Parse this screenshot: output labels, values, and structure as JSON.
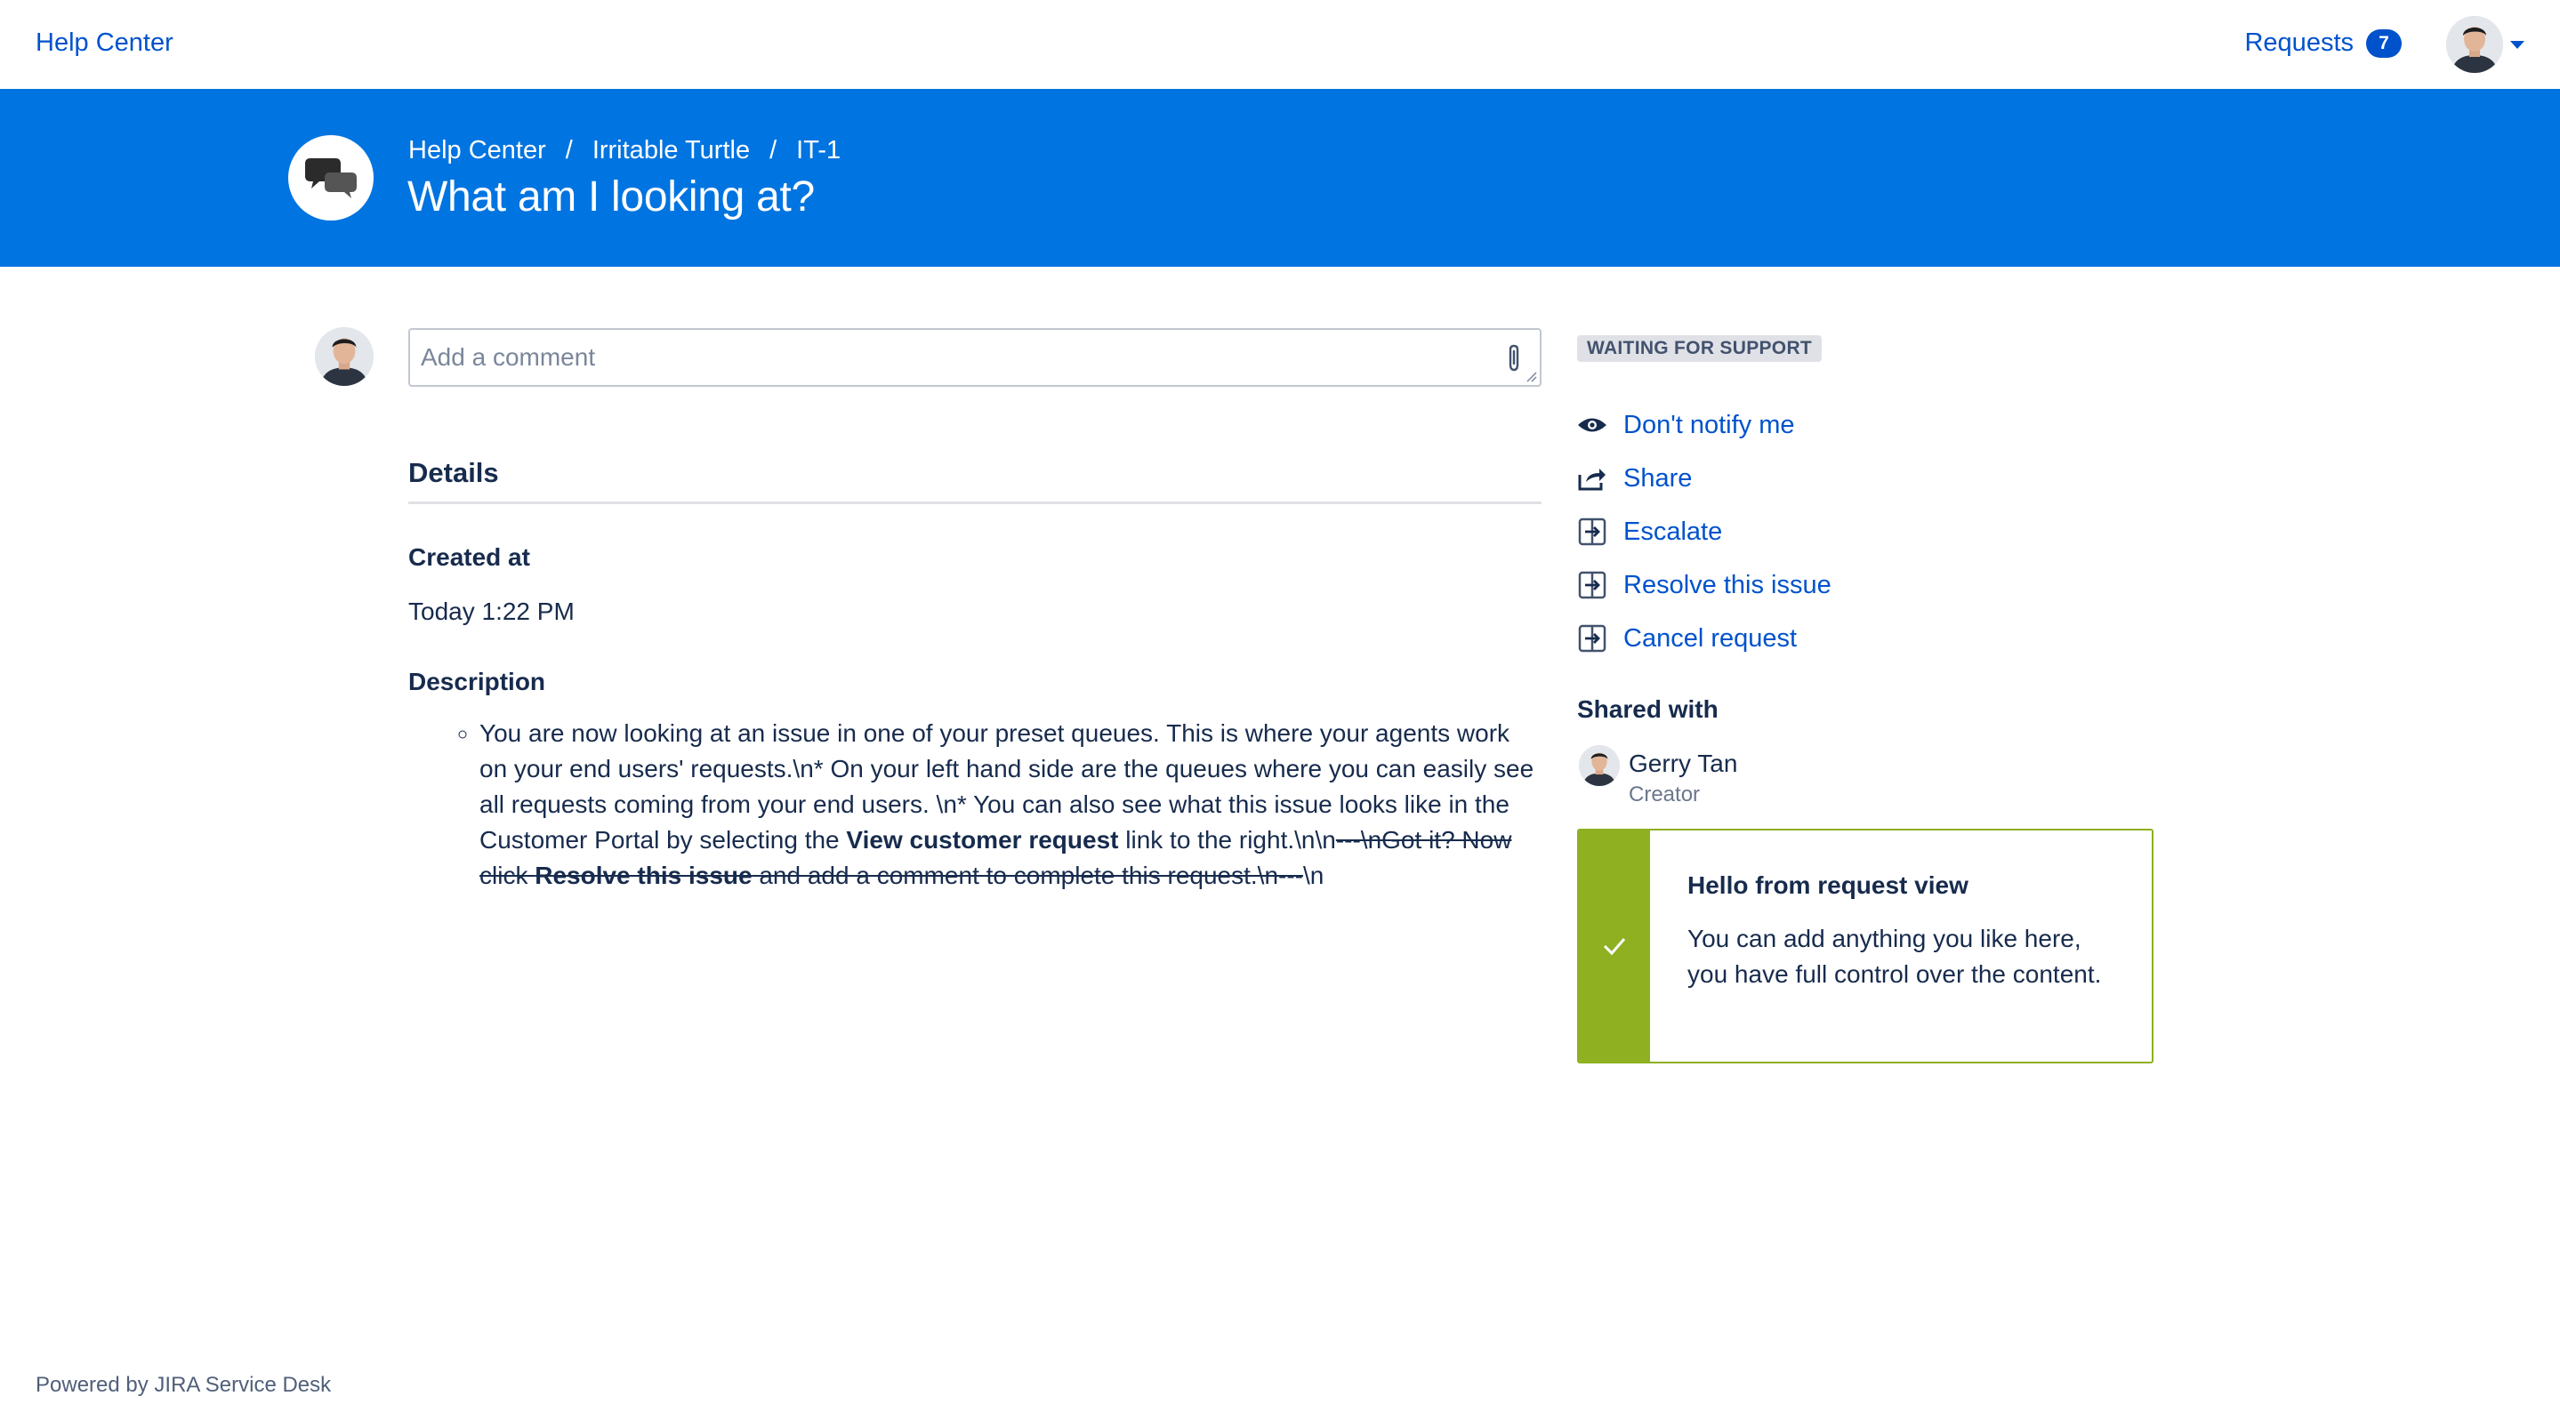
{
  "topbar": {
    "help_center": "Help Center",
    "requests_label": "Requests",
    "requests_count": "7",
    "user_menu_icon": "chevron-down-icon"
  },
  "banner": {
    "logo_icon": "speech-bubbles-icon",
    "breadcrumb": [
      "Help Center",
      "Irritable Turtle",
      "IT-1"
    ],
    "separator": "/",
    "title": "What am I looking at?"
  },
  "comment": {
    "placeholder": "Add a comment",
    "attach_icon": "paperclip-icon"
  },
  "details": {
    "heading": "Details",
    "created_label": "Created at",
    "created_value": "Today 1:22 PM",
    "description_label": "Description",
    "description": {
      "part1": "You are now looking at an issue in one of your preset queues. This is where your agents work on your end users' requests.\\n* On your left hand side are the queues where you can easily see all requests coming from your end users. \\n* You can also see what this issue looks like in the Customer Portal by selecting the ",
      "bold1": "View customer request",
      "part2": " link to the right.\\n\\n",
      "strike1": "---\\nGot it? Now click ",
      "strike_bold": "Resolve this issue",
      "strike2": " and add a comment to complete this request.\\n---",
      "part3": "\\n"
    }
  },
  "status": "WAITING FOR SUPPORT",
  "actions": [
    {
      "label": "Don't notify me",
      "icon": "eye-icon"
    },
    {
      "label": "Share",
      "icon": "share-icon"
    },
    {
      "label": "Escalate",
      "icon": "transition-icon"
    },
    {
      "label": "Resolve this issue",
      "icon": "transition-icon"
    },
    {
      "label": "Cancel request",
      "icon": "transition-icon"
    }
  ],
  "shared": {
    "heading": "Shared with",
    "name": "Gerry Tan",
    "role": "Creator"
  },
  "panel": {
    "title": "Hello from request view",
    "body": "You can add anything you like here, you have full control over the content.",
    "icon": "checkmark-icon",
    "accent": "#8eb021"
  },
  "footer": "Powered by JIRA Service Desk",
  "colors": {
    "banner": "#0074e0",
    "link": "#0052cc",
    "badge": "#0052cc",
    "status_bg": "#dfe1e6"
  }
}
